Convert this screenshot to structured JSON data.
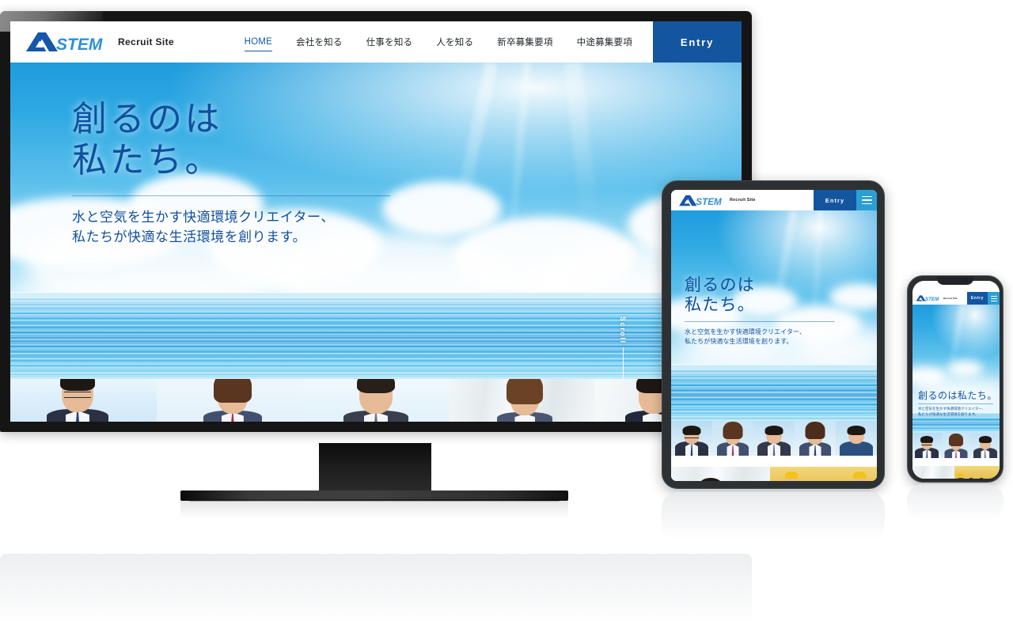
{
  "site": {
    "brand": {
      "logo_text": "ASTEM",
      "logo_a": "A",
      "logo_stem": "STEM",
      "tagline": "Recruit Site",
      "logo_color": "#1557a8",
      "logo_accent": "#2f8fd8"
    },
    "nav": {
      "items": [
        {
          "label": "HOME",
          "active": true
        },
        {
          "label": "会社を知る",
          "active": false
        },
        {
          "label": "仕事を知る",
          "active": false
        },
        {
          "label": "人を知る",
          "active": false
        },
        {
          "label": "新卒募集要項",
          "active": false
        },
        {
          "label": "中途募集要項",
          "active": false
        }
      ]
    },
    "entry_button": {
      "label": "Entry",
      "color": "#1455a0"
    },
    "menu_button": {
      "label": "menu",
      "color": "#2a9fd6"
    },
    "hero": {
      "title_desktop": "創るのは\n私たち。",
      "title_phone": "創るのは私たち。",
      "subtitle": "水と空気を生かす快適環境クリエイター、\n私たちが快適な生活環境を創ります。",
      "scroll_label": "Scroll",
      "title_color": "#0f4f9e"
    }
  },
  "devices": [
    {
      "name": "desktop-monitor",
      "label": "monitor"
    },
    {
      "name": "tablet",
      "label": "tablet"
    },
    {
      "name": "phone",
      "label": "phone"
    }
  ]
}
